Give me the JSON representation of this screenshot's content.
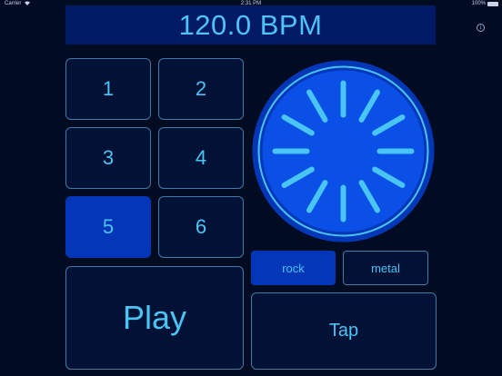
{
  "status_bar": {
    "carrier": "Carrier",
    "time": "2:31 PM",
    "battery": "100%"
  },
  "bpm_display": "120.0 BPM",
  "info_icon": "i",
  "beats": [
    "1",
    "2",
    "3",
    "4",
    "5",
    "6"
  ],
  "selected_beat": "5",
  "play_label": "Play",
  "tap_label": "Tap",
  "genres": [
    {
      "label": "rock",
      "selected": true
    },
    {
      "label": "metal",
      "selected": false
    }
  ],
  "colors": {
    "background": "#010b22",
    "header": "#011a66",
    "accent": "#48c4f5",
    "selected": "#0436b8",
    "dial_fill": "#0436b8",
    "dial_ring": "#3a7df0"
  },
  "icons": [
    "wifi-icon",
    "battery-icon",
    "info-icon",
    "tempo-dial-icon"
  ]
}
